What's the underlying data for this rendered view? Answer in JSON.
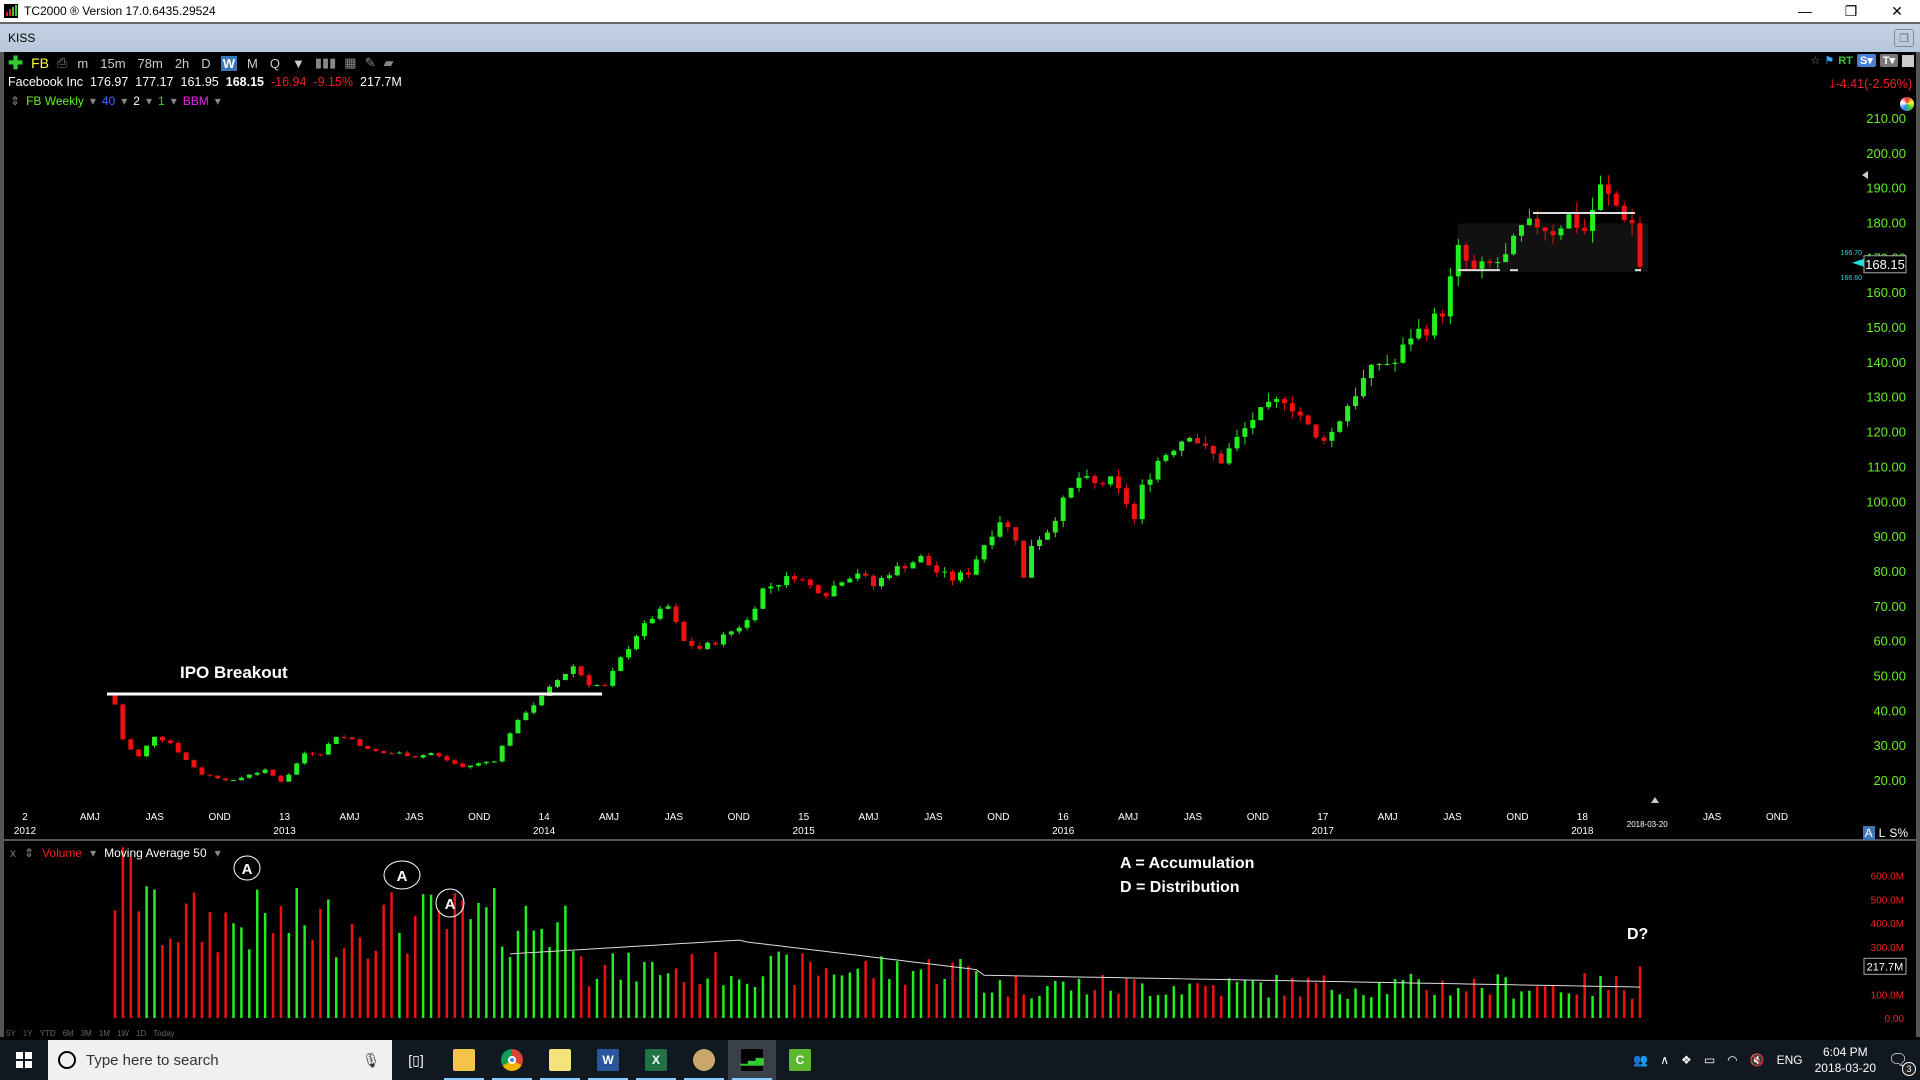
{
  "window": {
    "title": "TC2000 ® Version 17.0.6435.29524",
    "minimize": "—",
    "maximize": "❐",
    "close": "✕"
  },
  "tab": {
    "label": "KISS",
    "restore": "❐"
  },
  "toolbar": {
    "add": "✚",
    "symbol": "FB",
    "timeframes": [
      "m",
      "15m",
      "78m",
      "2h",
      "D",
      "W",
      "M",
      "Q"
    ],
    "active_timeframe": "W",
    "dropdown": "▼"
  },
  "quote": {
    "name": "Facebook Inc",
    "open": "176.97",
    "high": "177.17",
    "low": "161.95",
    "close": "168.15",
    "change": "-16.94",
    "change_pct": "-9.15%",
    "volume": "217.7M"
  },
  "chart_settings": {
    "name": "FB Weekly",
    "param1": "40",
    "param2": "2",
    "param3": "1",
    "indicator": "BBM",
    "colors": {
      "name": "#66ee22",
      "param1": "#4466ff",
      "param2": "#ffffff",
      "param3": "#22dd22",
      "indicator": "#ee22ee"
    }
  },
  "top_right": {
    "rt": "RT",
    "s": "S▾",
    "t": "T▾",
    "day_change": "-4.41",
    "day_change_pct": "(-2.56%)"
  },
  "axis_mode": {
    "a": "A",
    "l": "L",
    "s": "S%"
  },
  "annotations": {
    "ipo_label": "IPO Breakout",
    "legend_a": "A = Accumulation",
    "legend_d": "D = Distribution",
    "marks": [
      "A",
      "A",
      "A"
    ],
    "d_mark": "D?"
  },
  "volume_pane": {
    "close": "x",
    "label": "Volume",
    "ma_label": "Moving Average 50"
  },
  "ranges": [
    "5Y",
    "1Y",
    "YTD",
    "6M",
    "3M",
    "1M",
    "1W",
    "1D",
    "Today"
  ],
  "taskbar": {
    "search_placeholder": "Type here to search",
    "lang": "ENG",
    "time": "6:04 PM",
    "date": "2018-03-20",
    "notifications": "3"
  },
  "chart_data": {
    "type": "candlestick",
    "title": "FB Weekly",
    "price_axis": {
      "ticks": [
        "20.00",
        "30.00",
        "40.00",
        "50.00",
        "60.00",
        "70.00",
        "80.00",
        "90.00",
        "100.00",
        "110.00",
        "120.00",
        "130.00",
        "140.00",
        "150.00",
        "160.00",
        "170.00",
        "180.00",
        "190.00",
        "200.00",
        "210.00"
      ],
      "range": [
        16,
        214
      ],
      "last_price": "168.15",
      "bb_upper": "166.70",
      "bb_lower": "166.60"
    },
    "time_axis": {
      "ticks": [
        {
          "label": "2",
          "sub": "2012"
        },
        {
          "label": "AMJ"
        },
        {
          "label": "JAS"
        },
        {
          "label": "OND"
        },
        {
          "label": "13",
          "sub": "2013"
        },
        {
          "label": "AMJ"
        },
        {
          "label": "JAS"
        },
        {
          "label": "OND"
        },
        {
          "label": "14",
          "sub": "2014"
        },
        {
          "label": "AMJ"
        },
        {
          "label": "JAS"
        },
        {
          "label": "OND"
        },
        {
          "label": "15",
          "sub": "2015"
        },
        {
          "label": "AMJ"
        },
        {
          "label": "JAS"
        },
        {
          "label": "OND"
        },
        {
          "label": "16",
          "sub": "2016"
        },
        {
          "label": "AMJ"
        },
        {
          "label": "JAS"
        },
        {
          "label": "OND"
        },
        {
          "label": "17",
          "sub": "2017"
        },
        {
          "label": "AMJ"
        },
        {
          "label": "JAS"
        },
        {
          "label": "OND"
        },
        {
          "label": "18",
          "sub": "2018"
        },
        {
          "label": "2018-03-20"
        },
        {
          "label": "JAS"
        },
        {
          "label": "OND"
        }
      ]
    },
    "weekly_close_path": [
      [
        0,
        42
      ],
      [
        1,
        32
      ],
      [
        2,
        29
      ],
      [
        3,
        27
      ],
      [
        5,
        33
      ],
      [
        7,
        31
      ],
      [
        9,
        26
      ],
      [
        11,
        22
      ],
      [
        13,
        21
      ],
      [
        15,
        20
      ],
      [
        17,
        22
      ],
      [
        19,
        23
      ],
      [
        21,
        20
      ],
      [
        22,
        22
      ],
      [
        24,
        28
      ],
      [
        26,
        28
      ],
      [
        28,
        33
      ],
      [
        30,
        32
      ],
      [
        32,
        29
      ],
      [
        34,
        28
      ],
      [
        36,
        28
      ],
      [
        38,
        27
      ],
      [
        40,
        28
      ],
      [
        42,
        26
      ],
      [
        44,
        24
      ],
      [
        46,
        25
      ],
      [
        48,
        26
      ],
      [
        50,
        34
      ],
      [
        52,
        40
      ],
      [
        54,
        44
      ],
      [
        56,
        49
      ],
      [
        58,
        53
      ],
      [
        60,
        48
      ],
      [
        62,
        47
      ],
      [
        64,
        55
      ],
      [
        66,
        62
      ],
      [
        68,
        67
      ],
      [
        70,
        70
      ],
      [
        72,
        60
      ],
      [
        74,
        58
      ],
      [
        76,
        60
      ],
      [
        78,
        63
      ],
      [
        80,
        66
      ],
      [
        82,
        75
      ],
      [
        84,
        77
      ],
      [
        86,
        79
      ],
      [
        88,
        76
      ],
      [
        90,
        74
      ],
      [
        92,
        78
      ],
      [
        94,
        80
      ],
      [
        96,
        76
      ],
      [
        98,
        80
      ],
      [
        100,
        82
      ],
      [
        102,
        84
      ],
      [
        104,
        80
      ],
      [
        106,
        78
      ],
      [
        108,
        80
      ],
      [
        110,
        88
      ],
      [
        112,
        95
      ],
      [
        114,
        90
      ],
      [
        115,
        78
      ],
      [
        116,
        88
      ],
      [
        118,
        92
      ],
      [
        120,
        100
      ],
      [
        122,
        107
      ],
      [
        124,
        105
      ],
      [
        126,
        106
      ],
      [
        128,
        100
      ],
      [
        129,
        95
      ],
      [
        130,
        104
      ],
      [
        132,
        112
      ],
      [
        134,
        116
      ],
      [
        136,
        120
      ],
      [
        138,
        115
      ],
      [
        140,
        112
      ],
      [
        142,
        118
      ],
      [
        144,
        124
      ],
      [
        146,
        127
      ],
      [
        148,
        130
      ],
      [
        150,
        125
      ],
      [
        152,
        118
      ],
      [
        154,
        120
      ],
      [
        156,
        128
      ],
      [
        158,
        135
      ],
      [
        160,
        140
      ],
      [
        162,
        140
      ],
      [
        164,
        148
      ],
      [
        166,
        150
      ],
      [
        168,
        155
      ],
      [
        170,
        172
      ],
      [
        172,
        166
      ],
      [
        174,
        168
      ],
      [
        176,
        170
      ],
      [
        178,
        178
      ],
      [
        180,
        180
      ],
      [
        182,
        178
      ],
      [
        184,
        182
      ],
      [
        186,
        178
      ],
      [
        188,
        190
      ],
      [
        190,
        185
      ],
      [
        192,
        180
      ],
      [
        193,
        168
      ]
    ],
    "volume_axis": {
      "ticks": [
        "0.00",
        "100.0M",
        "200.0M",
        "300.0M",
        "400.0M",
        "500.0M",
        "600.0M"
      ],
      "range": [
        0,
        640
      ],
      "last_volume": "217.7M",
      "ma_period": 50
    },
    "horizontal_lines": [
      {
        "label": "IPO Breakout",
        "price": 45
      },
      {
        "price": 166.6
      },
      {
        "price": 183
      }
    ],
    "up_color": "#22ee22",
    "down_color": "#ee1111"
  }
}
